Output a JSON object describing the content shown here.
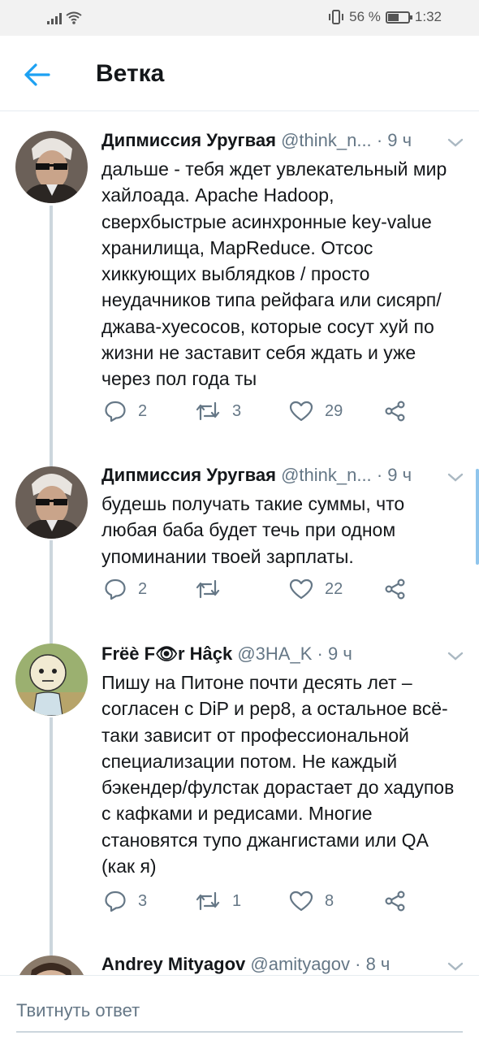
{
  "status_bar": {
    "battery_percent": "56 %",
    "battery_level": 0.56,
    "time": "1:32",
    "icons": [
      "signal-icon",
      "wifi-icon",
      "vibrate-icon",
      "battery-icon"
    ]
  },
  "header": {
    "title": "Ветка",
    "back_icon": "arrow-left-icon"
  },
  "colors": {
    "accent": "#1da1f2",
    "text": "#14171a",
    "secondary_text": "#657786",
    "divider": "#e6ecf0",
    "thread_line": "#ccd6dd",
    "scrollbar": "#8fc5ec"
  },
  "tweets": [
    {
      "name": "Дипмиссия Уругвая",
      "handle": "@think_n...",
      "dot": "·",
      "time": "9 ч",
      "text": "дальше - тебя ждет увлекательный мир хайлоада. Apache Hadoop, сверхбыстрые асинхронные key-value хранилища, MapReduce. Отсос хиккующих выблядков / просто неудачников типа рейфага или сисярп/джава-хуесосов, которые сосут хуй по жизни не заставит себя ждать и уже через пол года ты",
      "replies": "2",
      "retweets": "3",
      "likes": "29"
    },
    {
      "name": "Дипмиссия Уругвая",
      "handle": "@think_n...",
      "dot": "·",
      "time": "9 ч",
      "text": "будешь получать такие суммы, что любая баба будет течь при одном упоминании твоей зарплаты.",
      "replies": "2",
      "retweets": "",
      "likes": "22"
    },
    {
      "name": "Frëè F👁r Hâçk",
      "handle": "@3HA_K",
      "dot": "·",
      "time": "9 ч",
      "text": "Пишу на Питоне почти десять лет – согласен с DiP и pep8, а остальное всё-таки зависит от профессиональной специализации потом. Не каждый бэкендер/фулстак дорастает до хадупов с кафками и редисами. Многие становятся тупо джангистами или QA (как я)",
      "replies": "3",
      "retweets": "1",
      "likes": "8"
    },
    {
      "name": "Andrey Mityagov",
      "handle": "@amityagov",
      "dot": "·",
      "time": "8 ч"
    }
  ],
  "reply": {
    "placeholder": "Твитнуть ответ"
  }
}
